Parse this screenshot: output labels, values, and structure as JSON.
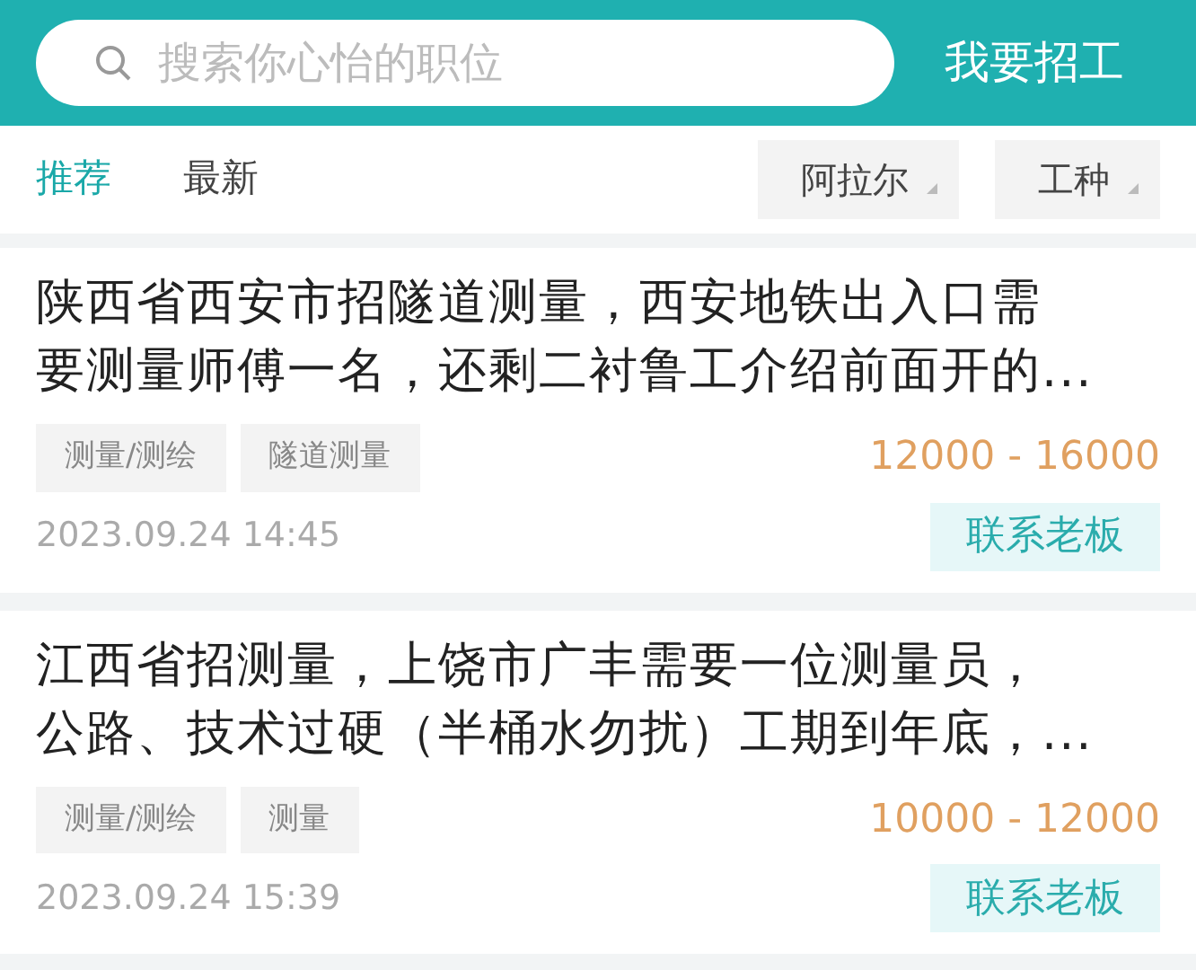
{
  "search": {
    "placeholder": "搜索你心怡的职位"
  },
  "post_button": "我要招工",
  "tabs": [
    {
      "label": "推荐",
      "selected": true
    },
    {
      "label": "最新",
      "selected": false
    }
  ],
  "filters": [
    "阿拉尔",
    "工种"
  ],
  "jobs": [
    {
      "title_lines": [
        "陕西省西安市招隧道测量，西安地铁出入口需",
        "要测量师傅一名，还剩二衬鲁工介绍前面开的..."
      ],
      "tags": [
        "测量/测绘",
        "隧道测量"
      ],
      "salary": "12000 - 16000",
      "date": "2023.09.24 14:45",
      "contact": "联系老板"
    },
    {
      "title_lines": [
        "江西省招测量，上饶市广丰需要一位测量员，",
        "公路、技术过硬（半桶水勿扰）工期到年底，..."
      ],
      "tags": [
        "测量/测绘",
        "测量"
      ],
      "salary": "10000 - 12000",
      "date": "2023.09.24 15:39",
      "contact": "联系老板"
    }
  ]
}
